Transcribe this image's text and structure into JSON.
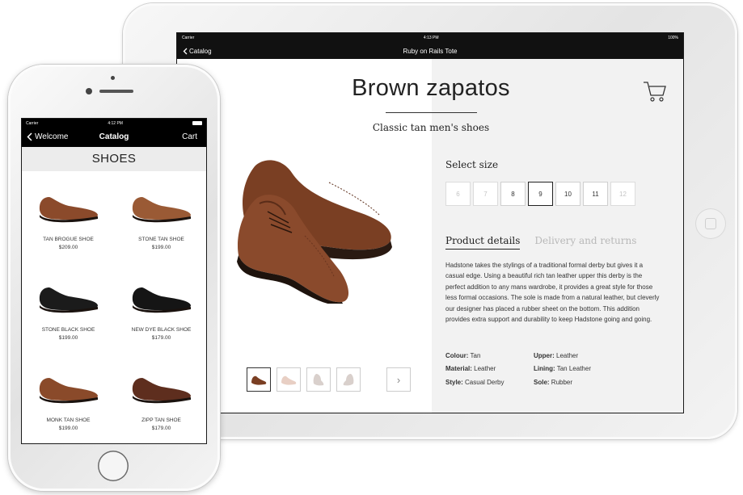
{
  "ipad": {
    "status": {
      "carrier": "Carrier",
      "time": "4:13 PM",
      "battery": "100%"
    },
    "nav": {
      "back_label": "Catalog",
      "title": "Ruby on Rails Tote"
    },
    "product": {
      "title": "Brown zapatos",
      "subtitle": "Classic tan men's shoes",
      "select_size_label": "Select size",
      "sizes": [
        {
          "label": "6",
          "state": "unavailable"
        },
        {
          "label": "7",
          "state": "unavailable"
        },
        {
          "label": "8",
          "state": "available"
        },
        {
          "label": "9",
          "state": "selected"
        },
        {
          "label": "10",
          "state": "available"
        },
        {
          "label": "11",
          "state": "available"
        },
        {
          "label": "12",
          "state": "unavailable"
        }
      ],
      "tabs": [
        {
          "label": "Product details",
          "active": true
        },
        {
          "label": "Delivery and returns",
          "active": false
        }
      ],
      "description": "Hadstone takes the stylings of a traditional formal derby but gives it a casual edge. Using a beautiful rich tan leather upper this derby is the perfect addition to any mans wardrobe, it provides a great style for those less formal occasions. The sole is made from a natural leather, but cleverly our designer has placed a rubber sheet on the bottom. This addition provides extra support and durability to keep Hadstone going and going.",
      "specs": {
        "colour_label": "Colour:",
        "colour": "Tan",
        "upper_label": "Upper:",
        "upper": "Leather",
        "material_label": "Material:",
        "material": "Leather",
        "lining_label": "Lining:",
        "lining": "Tan Leather",
        "style_label": "Style:",
        "style": "Casual Derby",
        "sole_label": "Sole:",
        "sole": "Rubber"
      },
      "gallery": {
        "next_arrow": "›",
        "thumbnail_count": 4,
        "active_index": 0
      }
    },
    "colors": {
      "bar": "#111111",
      "panel": "#f2f2f2",
      "shoe": "#8a4a2c"
    }
  },
  "iphone": {
    "status": {
      "carrier": "Carrier",
      "time": "4:12 PM"
    },
    "nav": {
      "back_label": "Welcome",
      "title": "Catalog",
      "cart_label": "Cart"
    },
    "section_title": "SHOES",
    "products": [
      {
        "name": "TAN BROGUE SHOE",
        "price": "$209.00",
        "color": "#8b4a2b"
      },
      {
        "name": "STONE TAN SHOE",
        "price": "$199.00",
        "color": "#9a5a35"
      },
      {
        "name": "STONE BLACK SHOE",
        "price": "$199.00",
        "color": "#1b1b1b"
      },
      {
        "name": "NEW DYE BLACK SHOE",
        "price": "$179.00",
        "color": "#151515"
      },
      {
        "name": "MONK TAN SHOE",
        "price": "$199.00",
        "color": "#8a4a2a"
      },
      {
        "name": "ZIPP TAN SHOE",
        "price": "$179.00",
        "color": "#5e2e1e"
      }
    ]
  }
}
